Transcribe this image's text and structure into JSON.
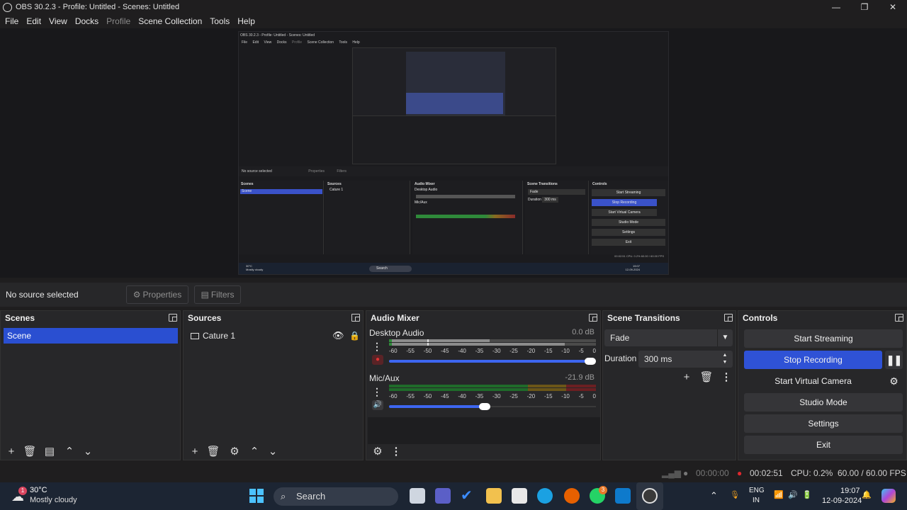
{
  "window": {
    "title": "OBS 30.2.3 - Profile: Untitled - Scenes: Untitled",
    "minimize": "—",
    "maximize": "❐",
    "close": "✕"
  },
  "menu": [
    "File",
    "Edit",
    "View",
    "Docks",
    "Profile",
    "Scene Collection",
    "Tools",
    "Help"
  ],
  "preview_nested": {
    "title": "OBS 30.2.3 - Profile: Untitled - Scenes: Untitled",
    "menu": [
      "File",
      "Edit",
      "View",
      "Docks",
      "Profile",
      "Scene Collection",
      "Tools",
      "Help"
    ],
    "no_source": "No source selected",
    "properties": "Properties",
    "filters": "Filters",
    "scenes": "Scenes",
    "scene": "Scene",
    "sources": "Sources",
    "source": "Cature 1",
    "audio_mixer": "Audio Mixer",
    "desktop_audio": "Desktop Audio",
    "mic_aux": "Mic/Aux",
    "scene_transitions": "Scene Transitions",
    "fade": "Fade",
    "duration": "Duration",
    "duration_value": "300 ms",
    "controls": "Controls",
    "start_streaming": "Start Streaming",
    "stop_recording": "Stop Recording",
    "start_virtual_camera": "Start Virtual Camera",
    "studio_mode": "Studio Mode",
    "settings": "Settings",
    "exit": "Exit",
    "status": "00:02:51   CPU: 0.2%   60.00 / 60.00 FPS",
    "weather_temp": "30°C",
    "weather_desc": "Mostly cloudy",
    "search": "Search",
    "time": "19:07",
    "date": "12-09-2024"
  },
  "source_bar": {
    "no_source": "No source selected",
    "properties": "Properties",
    "filters": "Filters"
  },
  "scenes": {
    "title": "Scenes",
    "items": [
      "Scene"
    ]
  },
  "sources": {
    "title": "Sources",
    "items": [
      "Cature 1"
    ]
  },
  "audio_mixer": {
    "title": "Audio Mixer",
    "ticks": [
      "-60",
      "-55",
      "-50",
      "-45",
      "-40",
      "-35",
      "-30",
      "-25",
      "-20",
      "-15",
      "-10",
      "-5",
      "0"
    ],
    "channels": [
      {
        "name": "Desktop Audio",
        "db": "0.0 dB",
        "volume": 1.0
      },
      {
        "name": "Mic/Aux",
        "db": "-21.9 dB",
        "volume": 0.46
      }
    ]
  },
  "scene_transitions": {
    "title": "Scene Transitions",
    "transition": "Fade",
    "duration_label": "Duration",
    "duration_value": "300 ms"
  },
  "controls": {
    "title": "Controls",
    "start_streaming": "Start Streaming",
    "stop_recording": "Stop Recording",
    "start_virtual_camera": "Start Virtual Camera",
    "studio_mode": "Studio Mode",
    "settings": "Settings",
    "exit": "Exit"
  },
  "status": {
    "stream_time": "00:00:00",
    "rec_time": "00:02:51",
    "cpu": "CPU: 0.2%",
    "fps": "60.00 / 60.00 FPS"
  },
  "taskbar": {
    "weather_badge": "1",
    "weather_temp": "30°C",
    "weather_desc": "Mostly cloudy",
    "search": "Search",
    "whatsapp_badge": "3",
    "lang_1": "ENG",
    "lang_2": "IN",
    "time": "19:07",
    "date": "12-09-2024"
  },
  "colors": {
    "accent": "#2f52d6",
    "selected_scene": "#2a4fd1",
    "record_red": "#e0282e",
    "bg": "#1f1e1f",
    "dock": "#272729"
  }
}
